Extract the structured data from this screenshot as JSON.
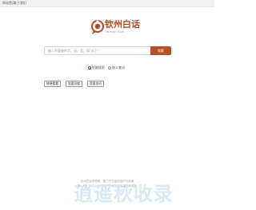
{
  "topnav": {
    "home": "网站首页",
    "about": "关于我们"
  },
  "logo": {
    "name": "钦州白话",
    "domain": "bunuan.com",
    "color": "#b8481f"
  },
  "search": {
    "placeholder": "输入你要查的字、词、音，如\"试下\"",
    "button": "搜索",
    "button_color": "#b5502a"
  },
  "modes": {
    "options": [
      "智能搜索",
      "按义查词"
    ],
    "selected": "智能搜索"
  },
  "quick_links": [
    "随便看看",
    "我要贡献",
    "我要发问"
  ],
  "footer": {
    "line1": "钦州白话资源网 - 致力于白话的保护与传承",
    "line2": "粤ICP备 2022-00 号 © 钦州白话 保留所有权利"
  },
  "watermark": {
    "text": "逍遥秋收录",
    "color": "#d4e8f8"
  }
}
